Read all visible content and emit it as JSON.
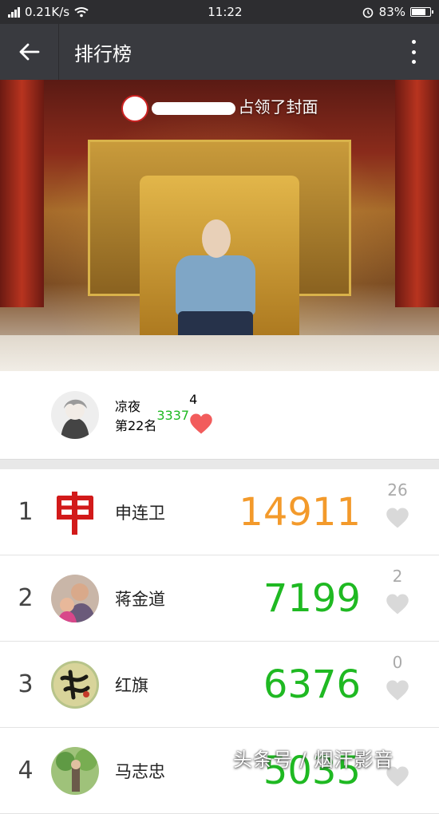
{
  "status_bar": {
    "speed": "0.21K/s",
    "time": "11:22",
    "battery": "83%",
    "battery_level": 0.83
  },
  "nav": {
    "title": "排行榜",
    "back_icon": "arrow-left-icon",
    "more_icon": "more-vertical-icon"
  },
  "cover": {
    "caption_suffix": "占领了封面"
  },
  "me": {
    "name": "凉夜",
    "rank_text": "第22名",
    "steps": "3337",
    "likes": "4",
    "liked": true
  },
  "ranking": [
    {
      "rank": "1",
      "name": "申连卫",
      "steps": "14911",
      "likes": "26",
      "color": "#f39a2b"
    },
    {
      "rank": "2",
      "name": "蒋金道",
      "steps": "7199",
      "likes": "2",
      "color": "#1fb922"
    },
    {
      "rank": "3",
      "name": "红旗",
      "steps": "6376",
      "likes": "0",
      "color": "#1fb922"
    },
    {
      "rank": "4",
      "name": "马志忠",
      "steps": "5035",
      "likes": "",
      "color": "#1fb922"
    }
  ],
  "colors": {
    "green": "#1fb922",
    "orange": "#f39a2b",
    "heart_active": "#f25c5c",
    "heart_inactive": "#d9d9d9"
  },
  "watermark": "头条号 / 烟汗影音"
}
